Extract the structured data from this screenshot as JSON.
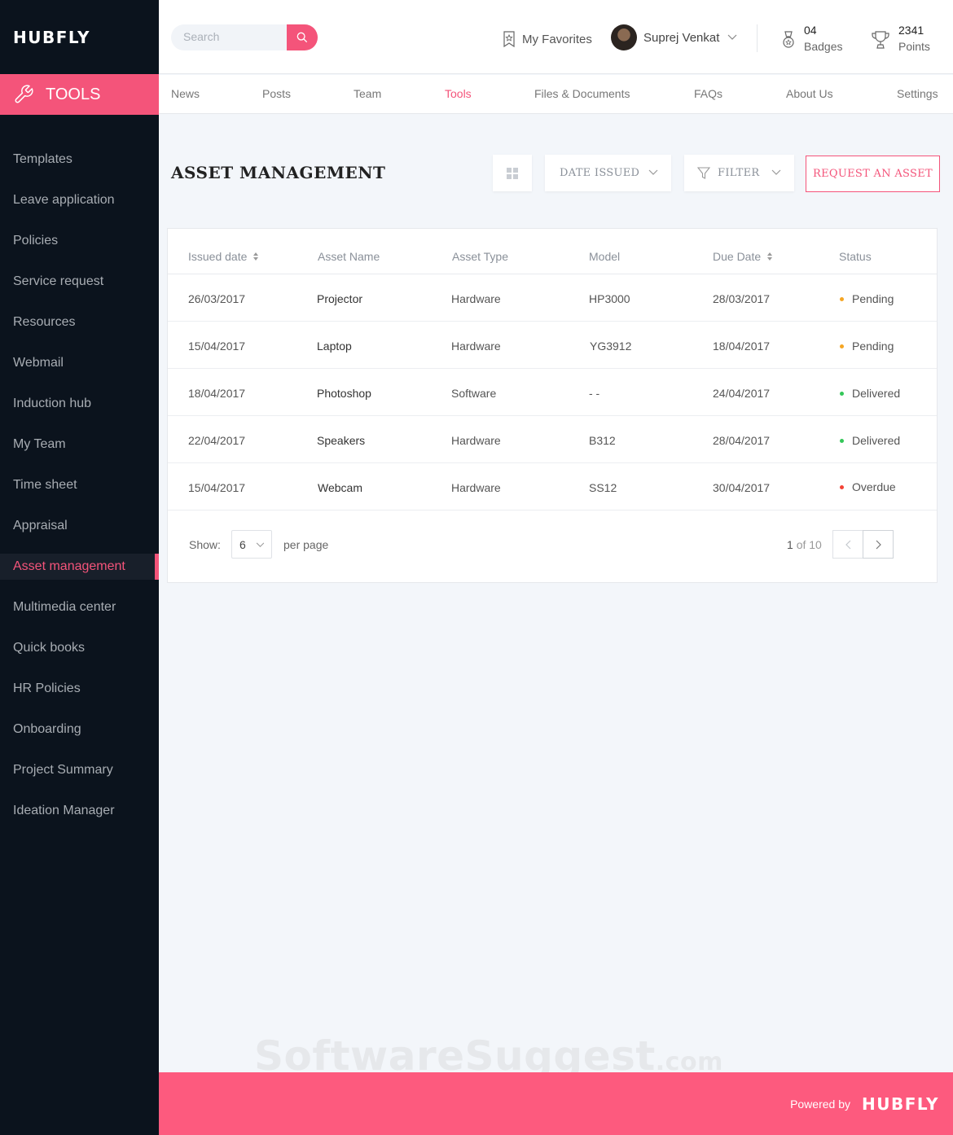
{
  "brand": "HUBFLY",
  "section_banner": {
    "label": "TOOLS",
    "icon": "wrench-icon"
  },
  "sidebar": {
    "items": [
      {
        "label": "Templates"
      },
      {
        "label": "Leave application"
      },
      {
        "label": "Policies"
      },
      {
        "label": "Service request"
      },
      {
        "label": "Resources"
      },
      {
        "label": "Webmail"
      },
      {
        "label": "Induction hub"
      },
      {
        "label": "My Team"
      },
      {
        "label": "Time sheet"
      },
      {
        "label": "Appraisal"
      },
      {
        "label": "Asset management",
        "active": true
      },
      {
        "label": "Multimedia center"
      },
      {
        "label": "Quick books"
      },
      {
        "label": "HR Policies"
      },
      {
        "label": "Onboarding"
      },
      {
        "label": "Project Summary"
      },
      {
        "label": "Ideation Manager"
      }
    ]
  },
  "header": {
    "search_placeholder": "Search",
    "favorites_label": "My Favorites",
    "user_name": "Suprej Venkat",
    "badges": {
      "count": "04",
      "label": "Badges"
    },
    "points": {
      "count": "2341",
      "label": "Points"
    }
  },
  "tabs": [
    {
      "label": "News"
    },
    {
      "label": "Posts"
    },
    {
      "label": "Team"
    },
    {
      "label": "Tools",
      "active": true
    },
    {
      "label": "Files & Documents"
    },
    {
      "label": "FAQs"
    },
    {
      "label": "About Us"
    },
    {
      "label": "Settings"
    }
  ],
  "main": {
    "title": "ASSET MANAGEMENT",
    "sort_label": "DATE ISSUED",
    "filter_label": "FILTER",
    "request_label": "REQUEST AN ASSET"
  },
  "table": {
    "columns": [
      "Issued date",
      "Asset Name",
      "Asset Type",
      "Model",
      "Due Date",
      "Status"
    ],
    "rows": [
      {
        "issued": "26/03/2017",
        "name": "Projector",
        "type": "Hardware",
        "model": "HP3000",
        "due": "28/03/2017",
        "status": "Pending"
      },
      {
        "issued": "15/04/2017",
        "name": "Laptop",
        "type": "Hardware",
        "model": "YG3912",
        "due": "18/04/2017",
        "status": "Pending"
      },
      {
        "issued": "18/04/2017",
        "name": "Photoshop",
        "type": "Software",
        "model": "- -",
        "due": "24/04/2017",
        "status": "Delivered"
      },
      {
        "issued": "22/04/2017",
        "name": "Speakers",
        "type": "Hardware",
        "model": "B312",
        "due": "28/04/2017",
        "status": "Delivered"
      },
      {
        "issued": "15/04/2017",
        "name": "Webcam",
        "type": "Hardware",
        "model": "SS12",
        "due": "30/04/2017",
        "status": "Overdue"
      }
    ],
    "status_colors": {
      "Pending": "#f5a623",
      "Delivered": "#34c759",
      "Overdue": "#f44336"
    }
  },
  "pagination": {
    "show_label": "Show:",
    "per_page_value": "6",
    "per_page_label": "per page",
    "current": "1",
    "of_label": "of 10"
  },
  "watermark": {
    "main": "SoftwareSuggest",
    "suffix": ".com"
  },
  "footer": {
    "powered_by": "Powered by",
    "brand": "HUBFLY"
  },
  "colors": {
    "accent": "#f4547a",
    "sidebar_bg": "#0b131d",
    "footer_bg": "#fd5a7e"
  }
}
